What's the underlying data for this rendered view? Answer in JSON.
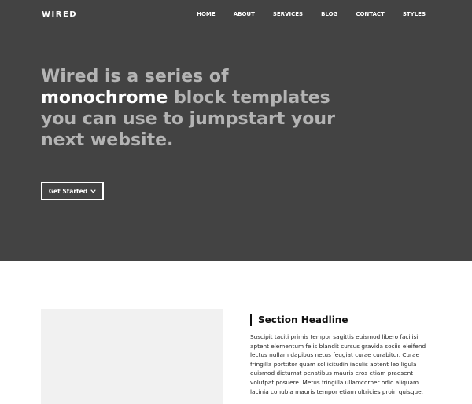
{
  "nav": {
    "brand": "WIRED",
    "items": [
      "HOME",
      "ABOUT",
      "SERVICES",
      "BLOG",
      "CONTACT",
      "STYLES"
    ]
  },
  "hero": {
    "headline_pre": "Wired is a series of",
    "headline_emph": "monochrome",
    "headline_post": "block templates you can use to jumpstart your next website.",
    "cta_label": "Get Started",
    "cta_icon": "chevron-down-icon"
  },
  "feature": {
    "title": "Section Headline",
    "body": "Suscipit taciti primis tempor sagittis euismod libero facilisi aptent elementum felis blandit cursus gravida sociis eleifend lectus nullam dapibus netus feugiat curae curabitur. Curae fringilla porttitor quam sollicitudin iaculis aptent leo ligula euismod dictumst penatibus mauris eros etiam praesent volutpat posuere. Metus fringilla ullamcorper odio aliquam lacinia conubia mauris tempor etiam ultricies proin quisque."
  },
  "colors": {
    "hero_bg": "#434343",
    "headline_muted": "#b4b4b4",
    "headline_emphasis": "#ffffff",
    "placeholder_bg": "#f1f1f1"
  }
}
